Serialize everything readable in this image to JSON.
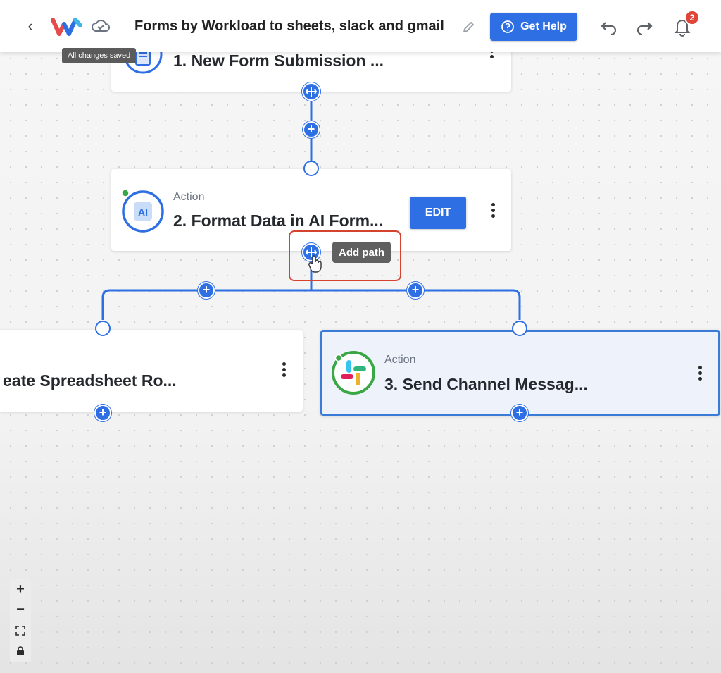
{
  "header": {
    "back_icon": "chevron-left-icon",
    "logo_icon": "workload-logo-icon",
    "cloud_icon": "cloud-saved-icon",
    "title": "Forms by Workload to sheets, slack and gmail",
    "rename_icon": "pencil-icon",
    "help_label": "Get Help",
    "help_icon": "question-circle-icon",
    "undo_icon": "undo-icon",
    "redo_icon": "redo-icon",
    "notification_icon": "bell-icon",
    "notification_count": "2",
    "saved_tooltip": "All changes saved"
  },
  "flow": {
    "steps": [
      {
        "label": "",
        "title": "1. New Form Submission ...",
        "icon": "form-document-icon"
      },
      {
        "label": "Action",
        "title": "2. Format Data in AI Form...",
        "icon": "ai-icon",
        "edit_label": "EDIT"
      },
      {
        "label": "",
        "title": "eate Spreadsheet Ro...",
        "icon": ""
      },
      {
        "label": "Action",
        "title": "3. Send Channel Messag...",
        "icon": "slack-icon"
      }
    ],
    "add_path_tooltip": "Add path",
    "accent_color": "#2f6fe4",
    "highlight_color": "#d5432e"
  },
  "zoom_controls": {
    "zoom_in": "+",
    "zoom_out": "−",
    "fit_icon": "fit-view-icon",
    "lock_icon": "lock-icon"
  }
}
